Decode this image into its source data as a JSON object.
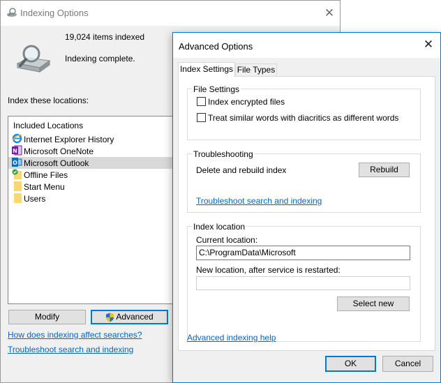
{
  "indexing_window": {
    "title": "Indexing Options",
    "close_glyph": "✕",
    "items_indexed": "19,024 items indexed",
    "status": "Indexing complete.",
    "locations_label": "Index these locations:",
    "locations_header": "Included Locations",
    "locations": [
      {
        "label": "Internet Explorer History",
        "icon": "internet-explorer-icon"
      },
      {
        "label": "Microsoft OneNote",
        "icon": "onenote-icon"
      },
      {
        "label": "Microsoft Outlook",
        "icon": "outlook-icon",
        "selected": true
      },
      {
        "label": "Offline Files",
        "icon": "offline-files-folder-icon"
      },
      {
        "label": "Start Menu",
        "icon": "folder-icon"
      },
      {
        "label": "Users",
        "icon": "folder-icon"
      }
    ],
    "modify_label": "Modify",
    "advanced_label": "Advanced",
    "how_link": "How does indexing affect searches?",
    "troubleshoot_link": "Troubleshoot search and indexing"
  },
  "advanced_dialog": {
    "title": "Advanced Options",
    "close_glyph": "✕",
    "tabs": [
      {
        "label": "Index Settings",
        "active": true
      },
      {
        "label": "File Types",
        "active": false
      }
    ],
    "file_settings": {
      "label": "File Settings",
      "encrypted_label": "Index encrypted files",
      "encrypted_checked": false,
      "diacritics_label": "Treat similar words with diacritics as different words",
      "diacritics_checked": false
    },
    "troubleshooting": {
      "label": "Troubleshooting",
      "rebuild_text": "Delete and rebuild index",
      "rebuild_button": "Rebuild",
      "troubleshoot_link": "Troubleshoot search and indexing"
    },
    "index_location": {
      "label": "Index location",
      "current_label": "Current location:",
      "current_value": "C:\\ProgramData\\Microsoft",
      "new_label": "New location, after service is restarted:",
      "new_value": "",
      "select_new_button": "Select new"
    },
    "help_link": "Advanced indexing help",
    "ok_label": "OK",
    "cancel_label": "Cancel"
  },
  "colors": {
    "accent": "#0078d7",
    "link": "#0066cc",
    "selection": "#d9d9d9"
  }
}
